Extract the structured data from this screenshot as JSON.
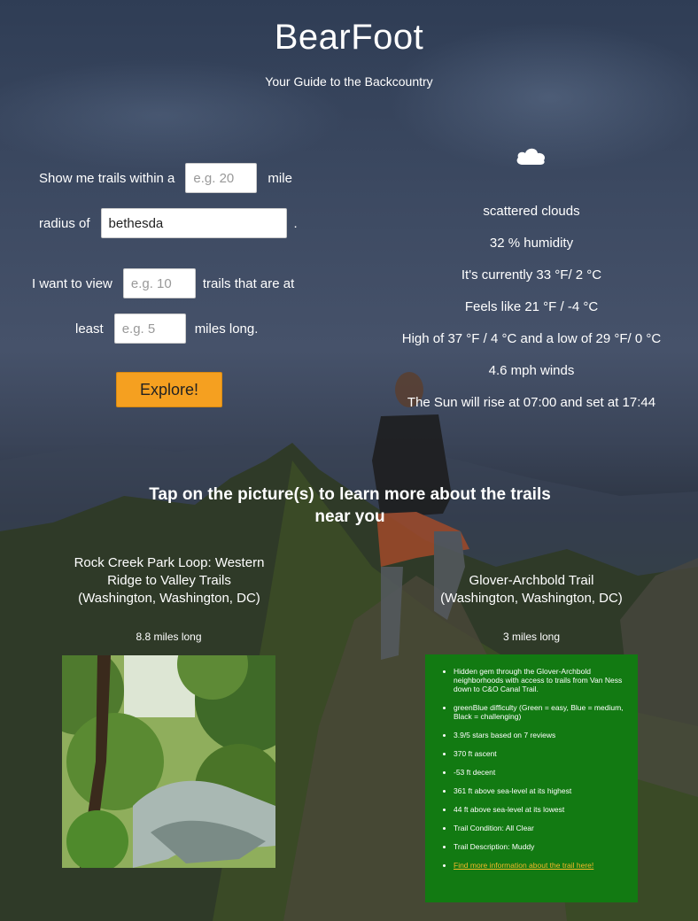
{
  "app": {
    "title": "BearFoot",
    "subtitle": "Your Guide to the Backcountry"
  },
  "search_form": {
    "row1_prefix": "Show me trails within a",
    "radius_placeholder": "e.g. 20",
    "row1_suffix": "mile",
    "row2_prefix": "radius of",
    "location_value": "bethesda",
    "row2_suffix": ".",
    "row3_prefix": "I want to view",
    "count_placeholder": "e.g. 10",
    "row3_suffix": "trails that are at",
    "row4_prefix": "least",
    "length_placeholder": "e.g. 5",
    "row4_suffix": "miles long.",
    "explore_label": "Explore!"
  },
  "weather": {
    "icon": "cloud-icon",
    "description": "scattered clouds",
    "humidity": "32 % humidity",
    "current": "It's currently 33 °F/ 2 °C",
    "feels_like": "Feels like 21 °F / -4 °C",
    "high_low": "High of 37 °F / 4 °C and a low of 29 °F/ 0 °C",
    "wind": "4.6 mph winds",
    "sun": "The Sun will rise at 07:00 and set at 17:44"
  },
  "trails_heading": "Tap on the picture(s) to learn more about the trails near you",
  "trails": [
    {
      "title_line1": "Rock Creek Park Loop: Western",
      "title_line2": "Ridge to Valley Trails",
      "title_line3": "(Washington, Washington, DC)",
      "length": "8.8 miles long"
    },
    {
      "title_line1": "Glover-Archbold Trail",
      "title_line2": "(Washington, Washington, DC)",
      "length": "3 miles long",
      "details": [
        "Hidden gem through the Glover-Archbold neighborhoods with access to trails from Van Ness down to C&O Canal Trail.",
        "greenBlue difficulty (Green = easy, Blue = medium, Black = challenging)",
        "3.9/5 stars based on 7 reviews",
        "370 ft ascent",
        "-53 ft decent",
        "361 ft above sea-level at its highest",
        "44 ft above sea-level at its lowest",
        "Trail Condition: All Clear",
        "Trail Description: Muddy"
      ],
      "more_link": "Find more information about the trail here!"
    }
  ],
  "colors": {
    "accent": "#f5a020",
    "card_green": "#127a12",
    "link": "#f5b82a"
  }
}
